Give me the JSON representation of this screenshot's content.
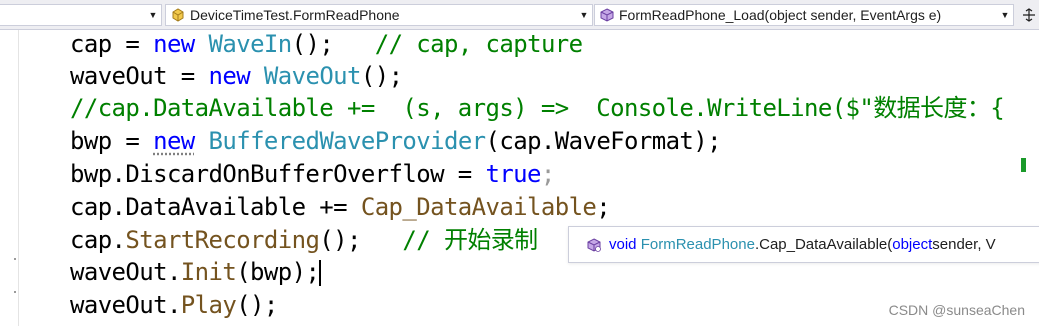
{
  "navbar": {
    "project_combo": "",
    "class_combo": "DeviceTimeTest.FormReadPhone",
    "member_combo": "FormReadPhone_Load(object sender, EventArgs e)",
    "split_icon": "split-editor-icon"
  },
  "code": {
    "line1": {
      "a": "cap = ",
      "b": "new",
      "c": " ",
      "d": "WaveIn",
      "e": "();   ",
      "f": "// cap, capture"
    },
    "line2": {
      "a": "waveOut = ",
      "b": "new",
      "c": " ",
      "d": "WaveOut",
      "e": "();"
    },
    "line3": {
      "a": "//cap.DataAvailable +=  (s, args) =>  Console.WriteLine($\"数据长度：{"
    },
    "line4": {
      "a": "bwp = ",
      "b": "new",
      "c": " ",
      "d": "BufferedWaveProvider",
      "e": "(cap.WaveFormat);"
    },
    "line5": {
      "a": "bwp.DiscardOnBufferOverflow = ",
      "b": "true",
      "c": ";"
    },
    "line6": {
      "a": "cap.DataAvailable += ",
      "b": "Cap_DataAvailable",
      "c": ";"
    },
    "line7": {
      "a": "cap.",
      "b": "StartRecording",
      "c": "();   ",
      "d": "// 开始录制"
    },
    "line8": {
      "a": "waveOut.",
      "b": "Init",
      "c": "(bwp);"
    },
    "line9": {
      "a": "waveOut.",
      "b": "Play",
      "c": "();"
    }
  },
  "tooltip": {
    "kw": "void",
    "type": "FormReadPhone",
    "method": ".Cap_DataAvailable(",
    "param_kw": "object",
    "rest": " sender, V"
  },
  "watermark": "CSDN @sunseaChen",
  "colors": {
    "keyword": "#0000ff",
    "type": "#2b91af",
    "comment": "#008000",
    "method": "#74531f",
    "overview_mark": "#1a9a2a"
  }
}
